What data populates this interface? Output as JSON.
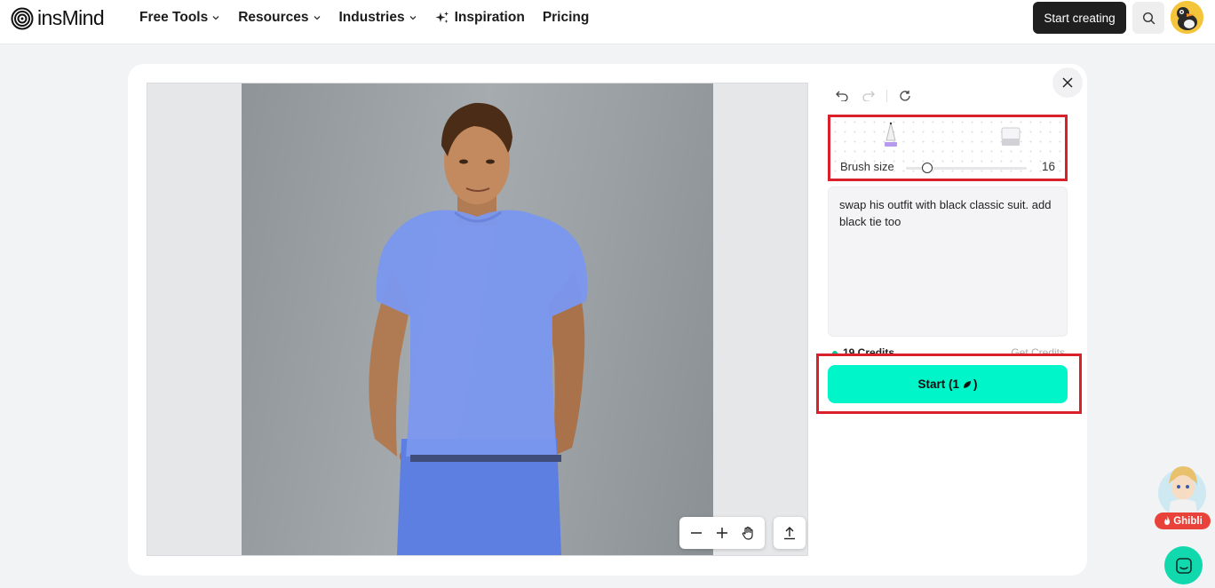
{
  "nav": {
    "logo_text": "insMind",
    "menu": [
      {
        "label": "Free Tools",
        "has_dropdown": true
      },
      {
        "label": "Resources",
        "has_dropdown": true
      },
      {
        "label": "Industries",
        "has_dropdown": true
      }
    ],
    "inspiration": "Inspiration",
    "pricing": "Pricing",
    "start_creating": "Start creating",
    "icons": {
      "search": "search-icon",
      "avatar": "bird-avatar"
    }
  },
  "editor": {
    "brush_label": "Brush size",
    "brush_value": "16",
    "brush_fraction": 0.18,
    "prompt_text": "swap his outfit with black classic suit. add black tie too",
    "credits_text": "19 Credits",
    "get_credits": "Get Credits",
    "start_label": "Start (1",
    "start_suffix": ")",
    "highlight_color": "#d9202b",
    "accent_color": "#00f5c9",
    "mask_color": "#6f8ff0"
  },
  "widgets": {
    "ghibli_label": "Ghibli"
  }
}
